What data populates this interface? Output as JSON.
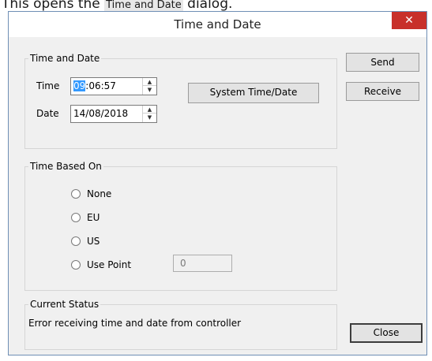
{
  "caption": {
    "before": "This opens the ",
    "keyword": "Time and Date",
    "after": " dialog."
  },
  "window": {
    "title": "Time and Date",
    "close_glyph": "✕"
  },
  "time_date_group": {
    "legend": "Time and Date",
    "time_label": "Time",
    "time_value_selected": "09",
    "time_value_rest": ":06:57",
    "date_label": "Date",
    "date_value": "14/08/2018",
    "system_button": "System Time/Date"
  },
  "buttons": {
    "send": "Send",
    "receive": "Receive",
    "close": "Close"
  },
  "time_based_group": {
    "legend": "Time Based On",
    "options": [
      "None",
      "EU",
      "US",
      "Use Point"
    ],
    "use_point_value": "0"
  },
  "status_group": {
    "legend": "Current Status",
    "message": "Error receiving time and date from controller"
  },
  "icons": {
    "spin_up": "▲",
    "spin_down": "▼"
  }
}
